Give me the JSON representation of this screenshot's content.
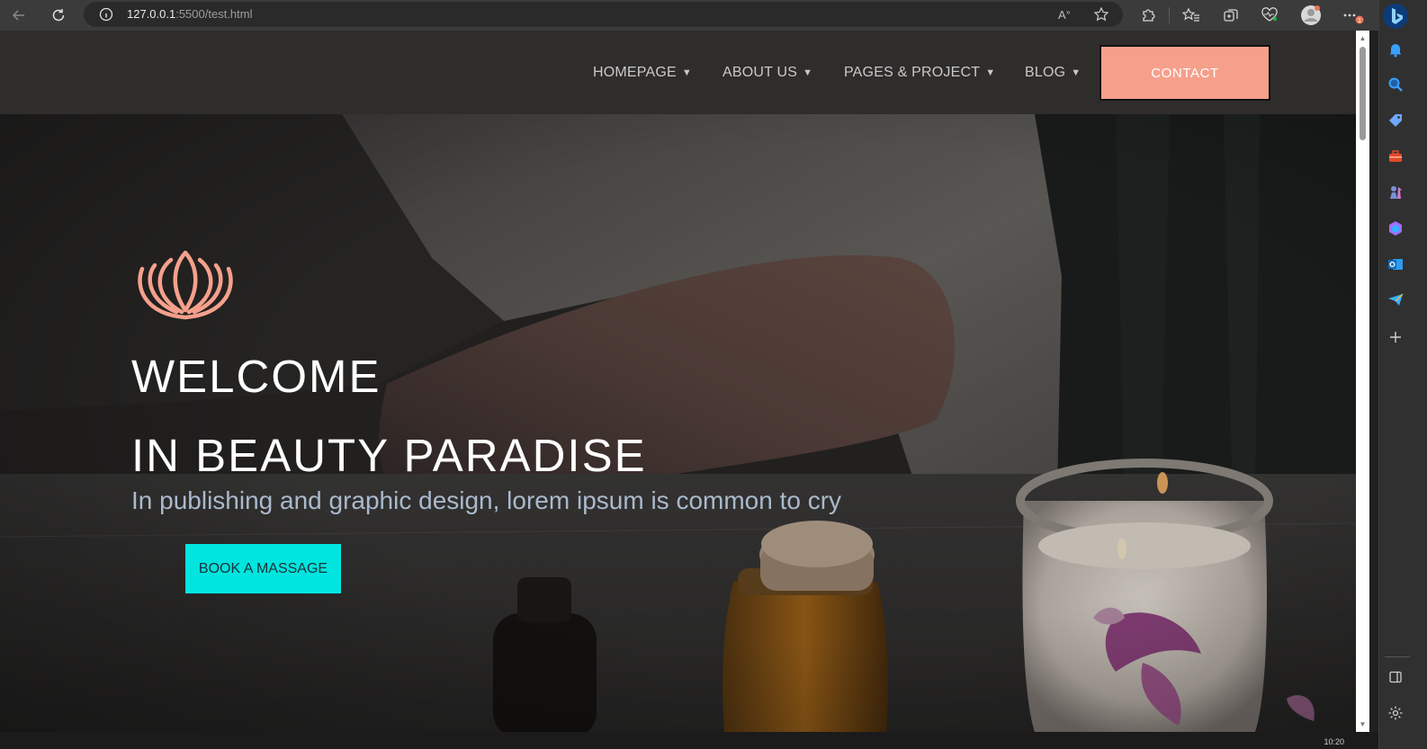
{
  "browser": {
    "url_host": "127.0.0.1",
    "url_rest": ":5500/test.html",
    "icons": {
      "back": "back-arrow-icon",
      "refresh": "refresh-icon",
      "site_info": "info-icon",
      "read_aloud": "read-aloud-icon",
      "favorite": "star-icon",
      "extensions": "puzzle-icon",
      "favorites_list": "favorites-icon",
      "collections": "collections-icon",
      "performance": "heart-icon",
      "profile": "profile-avatar-icon",
      "more": "more-icon",
      "copilot": "bing-icon"
    },
    "notification_count": "1"
  },
  "sidebar": {
    "items": [
      {
        "name": "bell-icon",
        "color": "#3aa0ff"
      },
      {
        "name": "search-icon",
        "color": "#3aa0ff"
      },
      {
        "name": "tag-icon",
        "color": "#6da7ff"
      },
      {
        "name": "toolbox-icon",
        "color": "#e24a2a"
      },
      {
        "name": "chess-icon",
        "color": "#c9a0ff"
      },
      {
        "name": "copilot-icon",
        "color": "#a56bff"
      },
      {
        "name": "outlook-icon",
        "color": "#1a8ad4"
      },
      {
        "name": "send-icon",
        "color": "#3ab0ff"
      },
      {
        "name": "plus-icon",
        "color": "#cfcfcf"
      }
    ],
    "bottom": [
      "sidebar-layout-icon",
      "settings-icon"
    ]
  },
  "nav": {
    "links": [
      {
        "label": "HOMEPAGE"
      },
      {
        "label": "ABOUT US"
      },
      {
        "label": "PAGES & PROJECT"
      },
      {
        "label": "BLOG"
      }
    ],
    "contact_label": "CONTACT"
  },
  "hero": {
    "title_line1": "WELCOME",
    "title_line2": "IN BEAUTY PARADISE",
    "subtitle": "In publishing and graphic design, lorem ipsum is common to cry",
    "cta_label": "BOOK A MASSAGE",
    "logo_icon": "lotus-icon"
  },
  "colors": {
    "accent_salmon": "#f6a08c",
    "accent_cyan": "#00e5df",
    "nav_bg": "#2f2d2c",
    "subtitle": "#aab9cc"
  },
  "taskbar": {
    "clock": "10:20"
  }
}
